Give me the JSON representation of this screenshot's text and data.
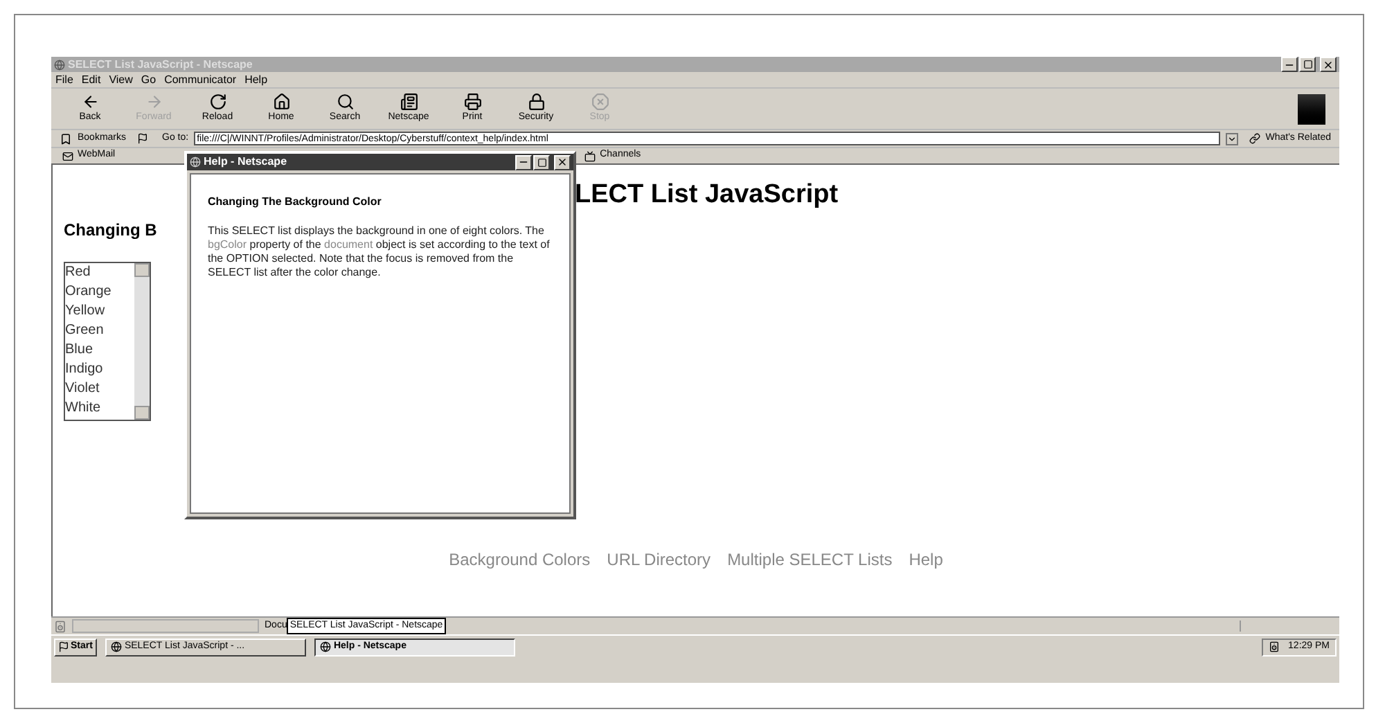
{
  "window": {
    "title": "SELECT List JavaScript - Netscape",
    "active": false
  },
  "menu": [
    "File",
    "Edit",
    "View",
    "Go",
    "Communicator",
    "Help"
  ],
  "toolbar": [
    {
      "label": "Back",
      "kind": "back",
      "disabled": false
    },
    {
      "label": "Forward",
      "kind": "forward",
      "disabled": true
    },
    {
      "label": "Reload",
      "kind": "reload",
      "disabled": false
    },
    {
      "label": "Home",
      "kind": "home",
      "disabled": false
    },
    {
      "label": "Search",
      "kind": "search",
      "disabled": false
    },
    {
      "label": "Netscape",
      "kind": "netscape",
      "disabled": false
    },
    {
      "label": "Print",
      "kind": "print",
      "disabled": false
    },
    {
      "label": "Security",
      "kind": "security",
      "disabled": false
    },
    {
      "label": "Stop",
      "kind": "stop",
      "disabled": true
    }
  ],
  "location": {
    "bookmarks": "Bookmarks",
    "go_to": "Go to:",
    "url": "file:///C|/WINNT/Profiles/Administrator/Desktop/Cyberstuff/context_help/index.html",
    "related": "What's Related"
  },
  "personal_toolbar": [
    "WebMail",
    "Channels"
  ],
  "page": {
    "title_visible": "LECT List JavaScript",
    "subheading_visible": "Changing B",
    "colors": [
      {
        "label": "Red",
        "selected": false
      },
      {
        "label": "Orange",
        "selected": false
      },
      {
        "label": "Yellow",
        "selected": false
      },
      {
        "label": "Green",
        "selected": false
      },
      {
        "label": "Blue",
        "selected": false
      },
      {
        "label": "Indigo",
        "selected": false
      },
      {
        "label": "Violet",
        "selected": false
      },
      {
        "label": "White",
        "selected": false
      }
    ],
    "links": [
      "Background Colors",
      "URL Directory",
      "Multiple SELECT Lists",
      "Help"
    ]
  },
  "help_window": {
    "title": "Help - Netscape",
    "active": true,
    "heading": "Changing The Background Color",
    "paragraph": [
      {
        "kind": "text",
        "text": "This SELECT list displays the background in one of eight colors. The "
      },
      {
        "kind": "link",
        "text": "bgColor"
      },
      {
        "kind": "text",
        "text": " property of the "
      },
      {
        "kind": "link",
        "text": "document"
      },
      {
        "kind": "text",
        "text": " object is set according to the text of the OPTION selected. Note that the focus is removed from the SELECT list after the color change."
      }
    ]
  },
  "status_bar": {
    "text": "Docu"
  },
  "tooltip": "SELECT List JavaScript - Netscape",
  "taskbar": {
    "start": "Start",
    "buttons": [
      {
        "label": "SELECT List JavaScript - ...",
        "selected": false
      },
      {
        "label": "Help - Netscape",
        "selected": true
      }
    ],
    "clock": "12:29 PM"
  }
}
